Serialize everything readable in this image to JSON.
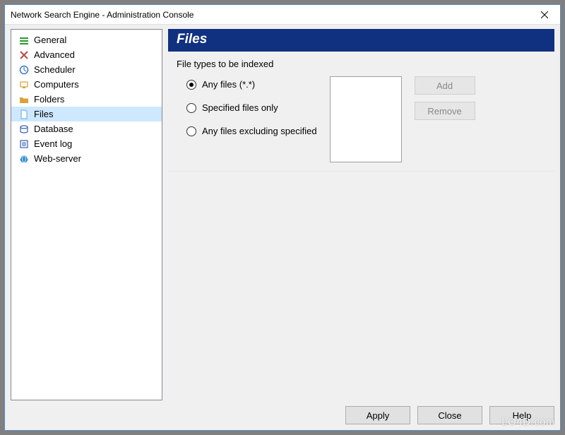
{
  "window": {
    "title": "Network Search Engine - Administration Console"
  },
  "sidebar": {
    "items": [
      {
        "label": "General",
        "icon_color": "#2e9a2e"
      },
      {
        "label": "Advanced",
        "icon_color": "#c04848"
      },
      {
        "label": "Scheduler",
        "icon_color": "#3a78c0"
      },
      {
        "label": "Computers",
        "icon_color": "#d9a23a"
      },
      {
        "label": "Folders",
        "icon_color": "#d9a23a"
      },
      {
        "label": "Files",
        "icon_color": "#6fb8e8"
      },
      {
        "label": "Database",
        "icon_color": "#3a5fb0"
      },
      {
        "label": "Event log",
        "icon_color": "#3a5fb0"
      },
      {
        "label": "Web-server",
        "icon_color": "#2e8bd0"
      }
    ],
    "selected_index": 5
  },
  "page": {
    "title": "Files",
    "section_label": "File types to be indexed",
    "radios": {
      "selected_index": 0,
      "options": [
        "Any files (*.*)",
        "Specified files only",
        "Any files excluding specified"
      ]
    },
    "list_items": [],
    "buttons": {
      "add": "Add",
      "remove": "Remove"
    }
  },
  "footer": {
    "apply": "Apply",
    "close": "Close",
    "help": "Help"
  },
  "watermark": "LO4D.com"
}
